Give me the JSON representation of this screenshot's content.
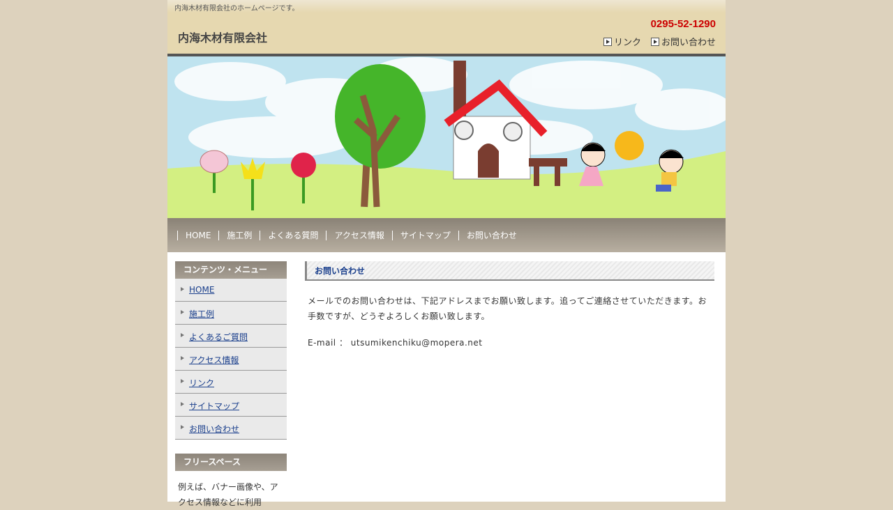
{
  "header": {
    "tagline": "内海木材有限会社のホームページです。",
    "site_title": "内海木材有限会社",
    "phone": "0295-52-1290",
    "links": [
      "リンク",
      "お問い合わせ"
    ]
  },
  "nav": [
    "HOME",
    "施工例",
    "よくある質問",
    "アクセス情報",
    "サイトマップ",
    "お問い合わせ"
  ],
  "sidebar": {
    "menu_title": "コンテンツ・メニュー",
    "items": [
      "HOME",
      "施工例",
      "よくあるご質問",
      "アクセス情報",
      "リンク",
      "サイトマップ",
      "お問い合わせ"
    ],
    "free_title": "フリースペース",
    "free_text": "例えば、バナー画像や、アクセス情報などに利用"
  },
  "main": {
    "title": "お問い合わせ",
    "paragraph": "メールでのお問い合わせは、下記アドレスまでお願い致します。追ってご連絡させていただきます。お手数ですが、どうぞよろしくお願い致します。",
    "email_line": "E-mail ： utsumikenchiku@mopera.net"
  },
  "colors": {
    "background": "#ddd2bd",
    "header_bg": "#e6d8b0",
    "phone": "#cc0000",
    "link": "#1a3f8c",
    "nav_bg": "#9c9487"
  }
}
